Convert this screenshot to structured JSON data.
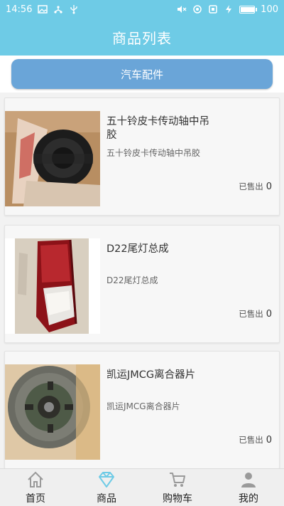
{
  "status_bar": {
    "time": "14:56",
    "battery_level": "100",
    "battery_fill_fraction": 1.0,
    "icons_left": [
      "image-icon",
      "usb-share-icon",
      "usb-icon"
    ],
    "icons_right": [
      "mute-icon",
      "sync-icon",
      "sim-icon",
      "battery-icon"
    ]
  },
  "header": {
    "title": "商品列表"
  },
  "category": {
    "label": "汽车配件"
  },
  "products": [
    {
      "name": "五十铃皮卡传动轴中吊胶",
      "desc": "五十铃皮卡传动轴中吊胶",
      "sold_label": "已售出",
      "sold_count": "0",
      "image": "center-bearing-photo"
    },
    {
      "name": "D22尾灯总成",
      "desc": "D22尾灯总成",
      "sold_label": "已售出",
      "sold_count": "0",
      "image": "tail-light-photo"
    },
    {
      "name": "凯运JMCG离合器片",
      "desc": "凯运JMCG离合器片",
      "sold_label": "已售出",
      "sold_count": "0",
      "image": "clutch-disc-photo"
    }
  ],
  "nav": [
    {
      "label": "首页",
      "icon": "home-icon",
      "active": false
    },
    {
      "label": "商品",
      "icon": "diamond-icon",
      "active": true
    },
    {
      "label": "购物车",
      "icon": "cart-icon",
      "active": false
    },
    {
      "label": "我的",
      "icon": "person-icon",
      "active": false
    }
  ],
  "colors": {
    "primary": "#6ecbe6",
    "category_button": "#6aa5d8",
    "nav_active": "#6ecbe6",
    "nav_inactive": "#9a9a9a"
  }
}
